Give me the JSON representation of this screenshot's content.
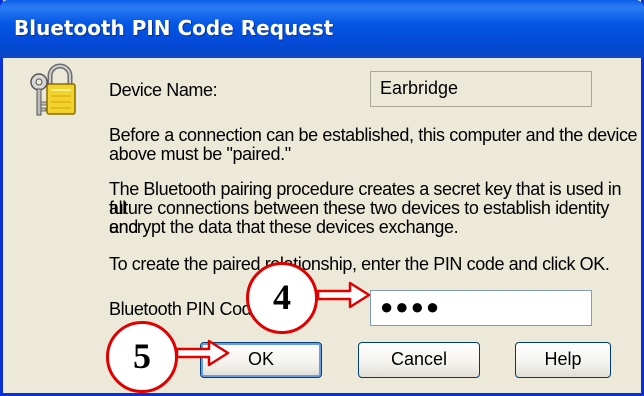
{
  "window": {
    "title": "Bluetooth PIN Code Request"
  },
  "icons": {
    "dialog_icon": "lock-key-icon"
  },
  "device": {
    "label": "Device Name:",
    "value": "Earbridge"
  },
  "paragraphs": {
    "p1_line1": "Before a connection can be established, this computer and the device",
    "p1_line2": "above must be \"paired.\"",
    "p2_line1": "The Bluetooth pairing procedure creates a secret key that is used in all",
    "p2_line2": "future connections between these two devices to establish identity and",
    "p2_line3": "encrypt the data that these devices exchange.",
    "p3_line1": "To create the paired relationship, enter the PIN code and click OK."
  },
  "pin": {
    "label": "Bluetooth PIN Code:",
    "masked_value": "●●●●"
  },
  "buttons": {
    "ok": "OK",
    "cancel": "Cancel",
    "help": "Help"
  },
  "annotations": {
    "step4": "4",
    "step5": "5"
  },
  "colors": {
    "titlebar": "#0a5ee8",
    "dialog_bg": "#ece9d8",
    "callout_border": "#e00000",
    "arrow": "#e00000"
  }
}
